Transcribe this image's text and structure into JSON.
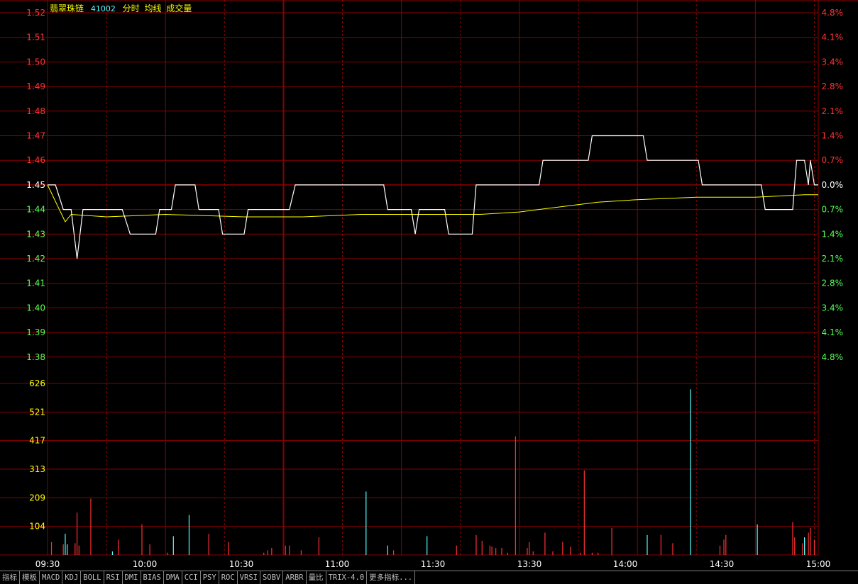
{
  "header": {
    "stock_name": "翡翠珠链",
    "stock_code": "41002",
    "mode_labels": [
      "分时",
      "均线",
      "成交量"
    ]
  },
  "price_axis": {
    "left_labels": [
      "1.52",
      "1.51",
      "1.50",
      "1.49",
      "1.48",
      "1.47",
      "1.46",
      "1.45",
      "1.44",
      "1.43",
      "1.42",
      "1.41",
      "1.40",
      "1.39",
      "1.38"
    ],
    "right_labels": [
      "4.8%",
      "4.1%",
      "3.4%",
      "2.8%",
      "2.1%",
      "1.4%",
      "0.7%",
      "0.0%",
      "0.7%",
      "1.4%",
      "2.1%",
      "2.8%",
      "3.4%",
      "4.1%",
      "4.8%"
    ],
    "prev_close": 1.45
  },
  "volume_axis": {
    "labels": [
      "626",
      "521",
      "417",
      "313",
      "209",
      "104"
    ]
  },
  "time_axis": {
    "labels": [
      "09:30",
      "10:00",
      "10:30",
      "11:00",
      "11:30",
      "13:30",
      "14:00",
      "14:30",
      "15:00"
    ]
  },
  "colors": {
    "up": "#ff3232",
    "down": "#54ff54",
    "flat": "#ffffff",
    "grid": "#8b0000",
    "price_line": "#ffffff",
    "avg_line": "#ffff00",
    "vol_up": "#ff3232",
    "vol_down": "#54ffff",
    "time_label": "#ffffff",
    "vol_label": "#ffff00",
    "name_color": "#ffff00",
    "code_color": "#54ffff",
    "mode_color": "#ffff00"
  },
  "chart_data": {
    "type": "line",
    "xlabel": "",
    "ylabel": "",
    "ylim": [
      1.38,
      1.52
    ],
    "series": [
      {
        "points": [
          [
            0,
            1.45
          ],
          [
            4,
            1.45
          ],
          [
            8,
            1.44
          ],
          [
            12,
            1.44
          ],
          [
            15,
            1.42
          ],
          [
            18,
            1.44
          ],
          [
            30,
            1.44
          ],
          [
            38,
            1.44
          ],
          [
            42,
            1.43
          ],
          [
            55,
            1.43
          ],
          [
            57,
            1.44
          ],
          [
            63,
            1.44
          ],
          [
            65,
            1.45
          ],
          [
            75,
            1.45
          ],
          [
            77,
            1.44
          ],
          [
            87,
            1.44
          ],
          [
            89,
            1.43
          ],
          [
            100,
            1.43
          ],
          [
            102,
            1.44
          ],
          [
            123,
            1.44
          ],
          [
            126,
            1.45
          ],
          [
            171,
            1.45
          ],
          [
            173,
            1.44
          ],
          [
            185,
            1.44
          ],
          [
            187,
            1.43
          ],
          [
            189,
            1.44
          ],
          [
            202,
            1.44
          ],
          [
            204,
            1.43
          ],
          [
            216,
            1.43
          ],
          [
            218,
            1.45
          ],
          [
            250,
            1.45
          ],
          [
            252,
            1.46
          ],
          [
            275,
            1.46
          ],
          [
            277,
            1.47
          ],
          [
            303,
            1.47
          ],
          [
            305,
            1.46
          ],
          [
            331,
            1.46
          ],
          [
            333,
            1.45
          ],
          [
            363,
            1.45
          ],
          [
            365,
            1.44
          ],
          [
            379,
            1.44
          ],
          [
            381,
            1.46
          ],
          [
            385,
            1.46
          ],
          [
            387,
            1.45
          ],
          [
            388,
            1.46
          ],
          [
            390,
            1.45
          ],
          [
            392,
            1.45
          ]
        ]
      },
      {
        "points": [
          [
            0,
            1.45
          ],
          [
            6,
            1.44
          ],
          [
            9,
            1.435
          ],
          [
            12,
            1.438
          ],
          [
            30,
            1.437
          ],
          [
            60,
            1.438
          ],
          [
            100,
            1.437
          ],
          [
            130,
            1.437
          ],
          [
            160,
            1.438
          ],
          [
            190,
            1.438
          ],
          [
            220,
            1.438
          ],
          [
            240,
            1.439
          ],
          [
            260,
            1.441
          ],
          [
            280,
            1.443
          ],
          [
            300,
            1.444
          ],
          [
            330,
            1.445
          ],
          [
            360,
            1.445
          ],
          [
            385,
            1.446
          ],
          [
            392,
            1.446
          ]
        ]
      }
    ],
    "volume_ylim": [
      0,
      730
    ],
    "volume_bars": [
      {
        "t": 2,
        "v": 55,
        "d": "up"
      },
      {
        "t": 8,
        "v": 45,
        "d": "up"
      },
      {
        "t": 9,
        "v": 90,
        "d": "down"
      },
      {
        "t": 10,
        "v": 45,
        "d": "down"
      },
      {
        "t": 14,
        "v": 50,
        "d": "up"
      },
      {
        "t": 15,
        "v": 180,
        "d": "up"
      },
      {
        "t": 16,
        "v": 40,
        "d": "up"
      },
      {
        "t": 22,
        "v": 240,
        "d": "up"
      },
      {
        "t": 33,
        "v": 15,
        "d": "down"
      },
      {
        "t": 36,
        "v": 65,
        "d": "up"
      },
      {
        "t": 48,
        "v": 130,
        "d": "up"
      },
      {
        "t": 52,
        "v": 45,
        "d": "up"
      },
      {
        "t": 61,
        "v": 10,
        "d": "up"
      },
      {
        "t": 64,
        "v": 80,
        "d": "down"
      },
      {
        "t": 72,
        "v": 170,
        "d": "down"
      },
      {
        "t": 82,
        "v": 90,
        "d": "up"
      },
      {
        "t": 92,
        "v": 55,
        "d": "up"
      },
      {
        "t": 110,
        "v": 10,
        "d": "up"
      },
      {
        "t": 112,
        "v": 20,
        "d": "up"
      },
      {
        "t": 114,
        "v": 30,
        "d": "up"
      },
      {
        "t": 121,
        "v": 40,
        "d": "up"
      },
      {
        "t": 123,
        "v": 40,
        "d": "up"
      },
      {
        "t": 129,
        "v": 20,
        "d": "up"
      },
      {
        "t": 138,
        "v": 75,
        "d": "up"
      },
      {
        "t": 162,
        "v": 270,
        "d": "down"
      },
      {
        "t": 173,
        "v": 40,
        "d": "down"
      },
      {
        "t": 176,
        "v": 20,
        "d": "up"
      },
      {
        "t": 193,
        "v": 80,
        "d": "down"
      },
      {
        "t": 208,
        "v": 40,
        "d": "up"
      },
      {
        "t": 218,
        "v": 85,
        "d": "up"
      },
      {
        "t": 221,
        "v": 60,
        "d": "up"
      },
      {
        "t": 225,
        "v": 40,
        "d": "up"
      },
      {
        "t": 226,
        "v": 35,
        "d": "up"
      },
      {
        "t": 228,
        "v": 30,
        "d": "up"
      },
      {
        "t": 231,
        "v": 30,
        "d": "up"
      },
      {
        "t": 234,
        "v": 10,
        "d": "up"
      },
      {
        "t": 238,
        "v": 505,
        "d": "up"
      },
      {
        "t": 244,
        "v": 30,
        "d": "up"
      },
      {
        "t": 245,
        "v": 55,
        "d": "up"
      },
      {
        "t": 247,
        "v": 15,
        "d": "up"
      },
      {
        "t": 253,
        "v": 95,
        "d": "up"
      },
      {
        "t": 257,
        "v": 15,
        "d": "up"
      },
      {
        "t": 262,
        "v": 55,
        "d": "up"
      },
      {
        "t": 266,
        "v": 35,
        "d": "up"
      },
      {
        "t": 271,
        "v": 10,
        "d": "up"
      },
      {
        "t": 273,
        "v": 360,
        "d": "up"
      },
      {
        "t": 277,
        "v": 10,
        "d": "up"
      },
      {
        "t": 280,
        "v": 10,
        "d": "up"
      },
      {
        "t": 287,
        "v": 115,
        "d": "up"
      },
      {
        "t": 305,
        "v": 85,
        "d": "down"
      },
      {
        "t": 312,
        "v": 85,
        "d": "up"
      },
      {
        "t": 318,
        "v": 50,
        "d": "up"
      },
      {
        "t": 327,
        "v": 705,
        "d": "down"
      },
      {
        "t": 342,
        "v": 40,
        "d": "up"
      },
      {
        "t": 344,
        "v": 65,
        "d": "up"
      },
      {
        "t": 345,
        "v": 85,
        "d": "up"
      },
      {
        "t": 361,
        "v": 130,
        "d": "down"
      },
      {
        "t": 379,
        "v": 140,
        "d": "up"
      },
      {
        "t": 380,
        "v": 75,
        "d": "up"
      },
      {
        "t": 384,
        "v": 50,
        "d": "up"
      },
      {
        "t": 385,
        "v": 75,
        "d": "down"
      },
      {
        "t": 387,
        "v": 95,
        "d": "up"
      },
      {
        "t": 388,
        "v": 115,
        "d": "up"
      },
      {
        "t": 390,
        "v": 65,
        "d": "up"
      }
    ]
  },
  "indicator_tabs": [
    "指标",
    "模板",
    "MACD",
    "KDJ",
    "BOLL",
    "RSI",
    "DMI",
    "BIAS",
    "DMA",
    "CCI",
    "PSY",
    "ROC",
    "VRSI",
    "SOBV",
    "ARBR",
    "量比",
    "TRIX-4.0",
    "更多指标..."
  ]
}
